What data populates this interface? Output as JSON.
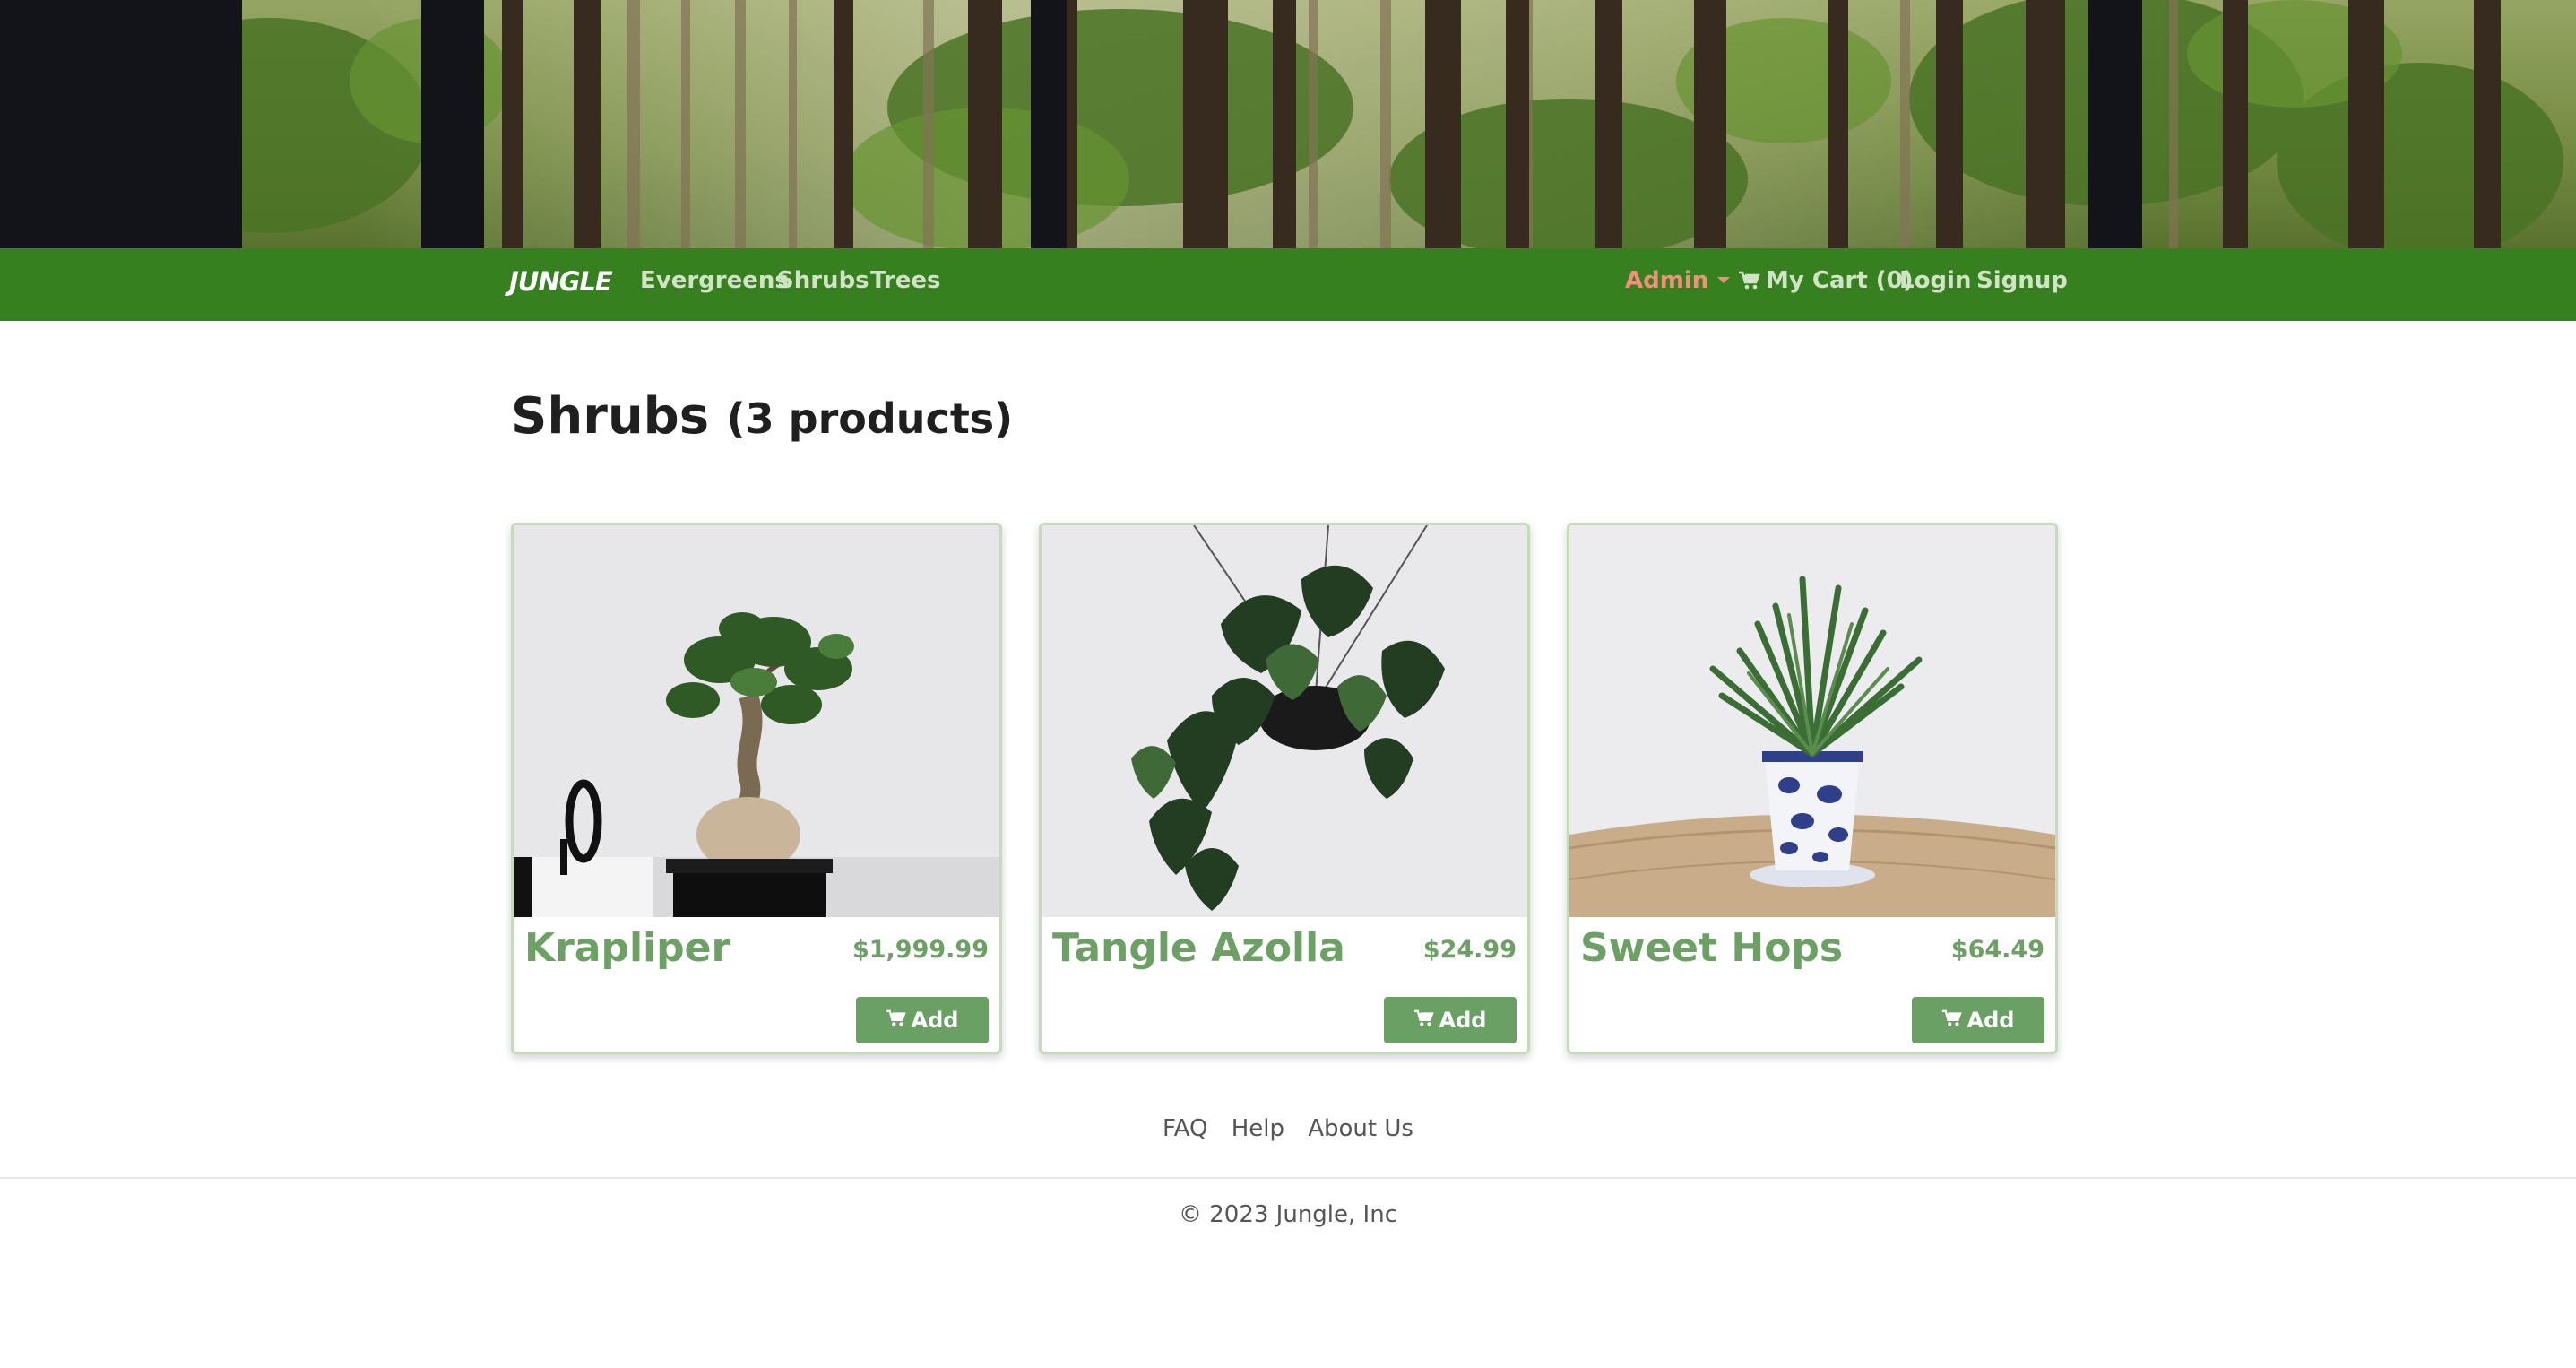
{
  "navbar": {
    "brand": "JUNGLE",
    "categories": [
      "Evergreens",
      "Shrubs",
      "Trees"
    ],
    "admin_label": "Admin",
    "cart_label": "My Cart (0)",
    "login_label": "Login",
    "signup_label": "Signup"
  },
  "heading": {
    "category": "Shrubs",
    "count_text": "(3 products)"
  },
  "products": [
    {
      "name": "Krapliper",
      "price": "$1,999.99",
      "add_label": "Add"
    },
    {
      "name": "Tangle Azolla",
      "price": "$24.99",
      "add_label": "Add"
    },
    {
      "name": "Sweet Hops",
      "price": "$64.49",
      "add_label": "Add"
    }
  ],
  "footer": {
    "links": [
      "FAQ",
      "Help",
      "About Us"
    ],
    "copyright": "© 2023 Jungle, Inc"
  },
  "colors": {
    "navbar_bg": "#37801f",
    "accent_green": "#6aa064",
    "admin_link": "#f0907a"
  },
  "icons": {
    "cart": "cart-icon",
    "caret": "caret-down-icon"
  }
}
